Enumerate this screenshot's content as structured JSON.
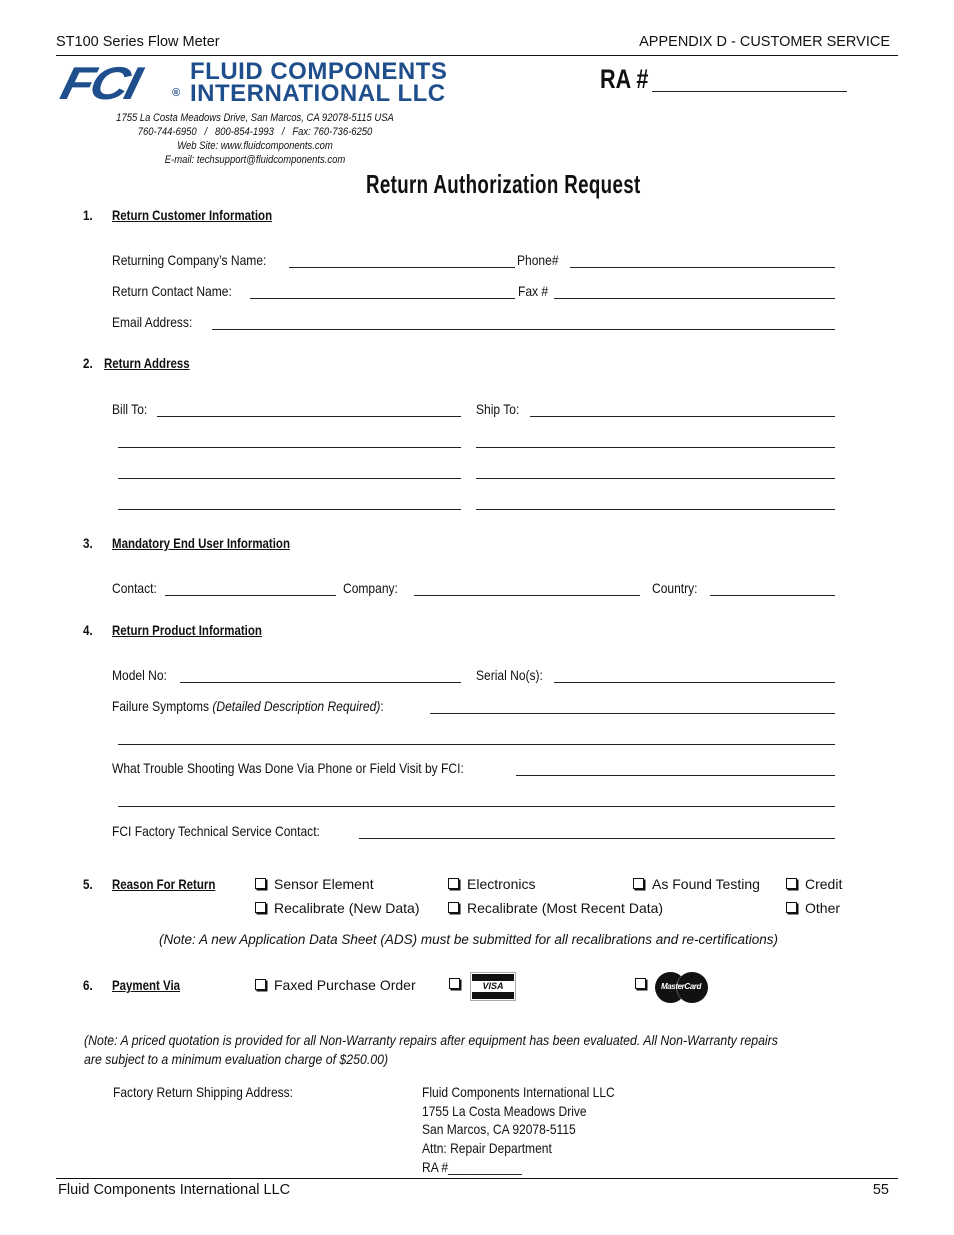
{
  "header": {
    "left": "ST100 Series Flow Meter",
    "right": "APPENDIX D - CUSTOMER SERVICE"
  },
  "company": {
    "logo_mark": "FCI",
    "logo_line1": "FLUID COMPONENTS",
    "logo_line2": "INTERNATIONAL LLC",
    "registered": "®",
    "address": "1755 La Costa Meadows Drive, San Marcos, CA 92078-5115 USA",
    "phones": "760-744-6950   /   800-854-1993   /   Fax: 760-736-6250",
    "website": "Web Site: www.fluidcomponents.com",
    "email": "E-mail: techsupport@fluidcomponents.com"
  },
  "ra_label": "RA #",
  "form_title": "Return  Authorization  Request",
  "sections": {
    "s1": {
      "number": "1.",
      "title": "Return Customer Information",
      "company_name_label": "Returning Company’s Name:",
      "phone_label": "Phone#",
      "contact_name_label": "Return Contact Name:",
      "fax_label": "Fax #",
      "email_label": "Email Address:"
    },
    "s2": {
      "number": "2.",
      "title": "Return Address",
      "bill_to_label": "Bill To:",
      "ship_to_label": "Ship To:"
    },
    "s3": {
      "number": "3.",
      "title": "Mandatory End User Information",
      "contact_label": "Contact:",
      "company_label": "Company:",
      "country_label": "Country:"
    },
    "s4": {
      "number": "4.",
      "title": "Return Product Information",
      "model_label": "Model No:",
      "serial_label": "Serial No(s):",
      "failure_label": "Failure Symptoms ",
      "failure_note": "(Detailed Description Required)",
      "failure_colon": ":",
      "troubleshoot_label": "What Trouble Shooting Was Done Via Phone or Field Visit by FCI:",
      "tech_contact_label": "FCI Factory Technical Service Contact:"
    },
    "s5": {
      "number": "5.",
      "title": "Reason For Return",
      "options": [
        "Sensor Element",
        "Electronics",
        "As Found Testing",
        "Credit",
        "Recalibrate (New Data)",
        "Recalibrate (Most Recent Data)",
        "Other"
      ],
      "note": "(Note: A new Application Data Sheet (ADS) must be submitted for all recalibrations and re-certifications)"
    },
    "s6": {
      "number": "6.",
      "title": "Payment Via",
      "options": [
        "Faxed Purchase Order",
        "VISA",
        "MasterCard"
      ]
    }
  },
  "pricing_note_line1": "(Note: A priced quotation is provided for all Non-Warranty repairs after equipment has been evaluated. All Non-Warranty repairs",
  "pricing_note_line2": "are subject to a minimum evaluation charge of $250.00)",
  "shipping": {
    "label": "Factory Return Shipping Address:",
    "lines": [
      "Fluid Components International LLC",
      "1755 La Costa Meadows Drive",
      "San Marcos, CA  92078-5115",
      "Attn:  Repair Department",
      "RA #___________"
    ]
  },
  "footer": {
    "left": "Fluid Components International LLC",
    "page": "55"
  }
}
